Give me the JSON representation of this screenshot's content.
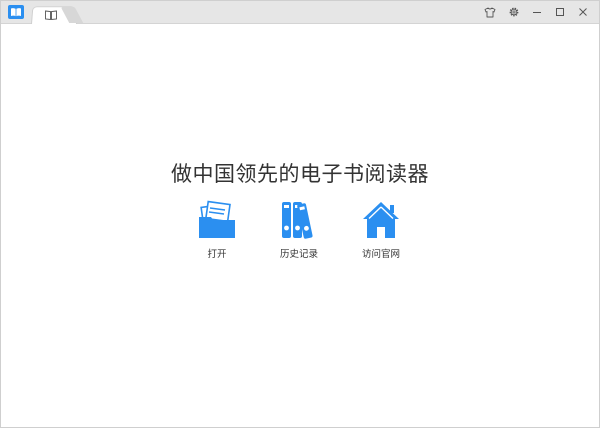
{
  "window": {
    "tab_icon": "book-icon",
    "controls": [
      "skin-icon",
      "gear-icon",
      "minimize-icon",
      "maximize-icon",
      "close-icon"
    ]
  },
  "main": {
    "tagline": "做中国领先的电子书阅读器",
    "actions": [
      {
        "label": "打开",
        "icon": "folder-icon"
      },
      {
        "label": "历史记录",
        "icon": "binders-icon"
      },
      {
        "label": "访问官网",
        "icon": "home-icon"
      }
    ]
  },
  "colors": {
    "accent": "#2b8ff0",
    "titlebar": "#e6e6e6",
    "text": "#333333"
  }
}
